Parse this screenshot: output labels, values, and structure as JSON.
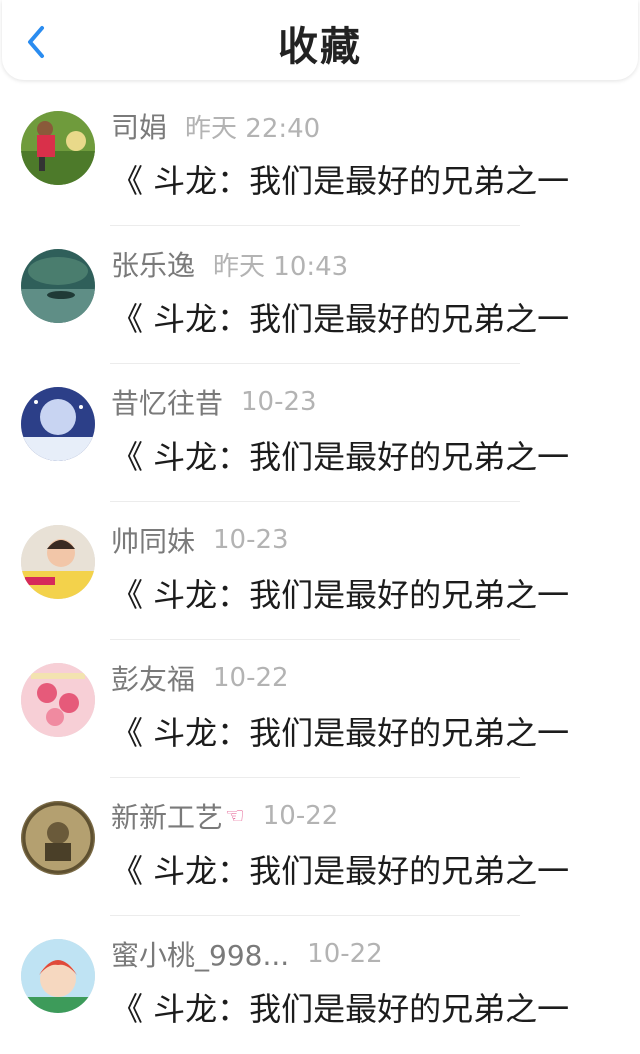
{
  "header": {
    "title": "收藏",
    "back_icon": "chevron-left-icon"
  },
  "colors": {
    "accent": "#2a8cf0",
    "name": "#7a7a7a",
    "time": "#b3b3b3",
    "content": "#1c1c1c"
  },
  "items": [
    {
      "name": "司娟",
      "emoji": "",
      "time": "昨天 22:40",
      "content": "《 斗龙：我们是最好的兄弟之一"
    },
    {
      "name": "张乐逸",
      "emoji": "",
      "time": "昨天 10:43",
      "content": "《 斗龙：我们是最好的兄弟之一"
    },
    {
      "name": "昔忆往昔",
      "emoji": "",
      "time": "10-23",
      "content": "《 斗龙：我们是最好的兄弟之一"
    },
    {
      "name": "帅同妹",
      "emoji": "",
      "time": "10-23",
      "content": "《 斗龙：我们是最好的兄弟之一"
    },
    {
      "name": "彭友福",
      "emoji": "",
      "time": "10-22",
      "content": "《 斗龙：我们是最好的兄弟之一"
    },
    {
      "name": "新新工艺",
      "emoji": "☜",
      "time": "10-22",
      "content": "《 斗龙：我们是最好的兄弟之一"
    },
    {
      "name": "蜜小桃_998...",
      "emoji": "",
      "time": "10-22",
      "content": "《 斗龙：我们是最好的兄弟之一"
    }
  ]
}
